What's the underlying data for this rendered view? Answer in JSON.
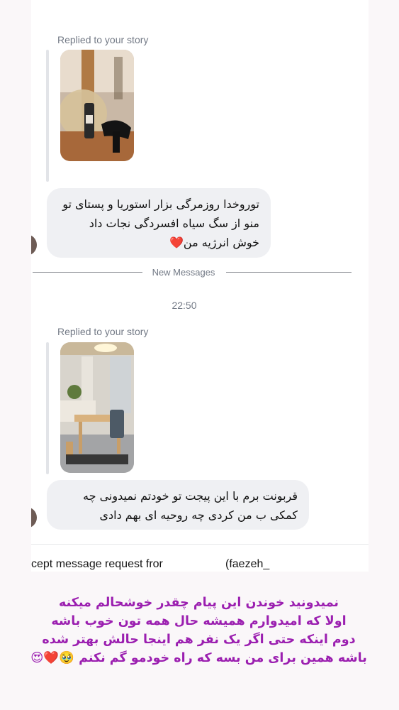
{
  "messages": [
    {
      "replied_label": "Replied to your story",
      "text_lines": [
        "توروخدا روزمرگی بزار استوریا و پستای تو",
        "منو از سگ سیاه افسردگی نجات داد",
        "خوش انرژیه من"
      ],
      "emoji": "❤️"
    },
    {
      "replied_label": "Replied to your story",
      "text_lines": [
        "قربونت برم با این پیجت تو خودتم نمیدونی چه",
        "کمکی ب من کردی چه روحیه ای بهم دادی"
      ]
    }
  ],
  "divider": {
    "label": "New Messages"
  },
  "timestamp": "22:50",
  "request": {
    "text": "cept message request fror",
    "name": "(faezeh_"
  },
  "caption": {
    "lines": [
      "نمیدونید خوندن این پیام چقدر خوشحالم میکنه",
      "اولا که امیدوارم همیشه حال همه تون خوب باشه",
      "دوم اینکه حتی اگر یک نفر هم اینجا حالش بهتر شده",
      "باشه همین برای من بسه که راه خودمو گم نکنم"
    ],
    "emojis": "🥹❤️😍"
  },
  "colors": {
    "caption": "#9b1fb0",
    "bubble": "#eff0f3",
    "muted": "#737a86"
  }
}
